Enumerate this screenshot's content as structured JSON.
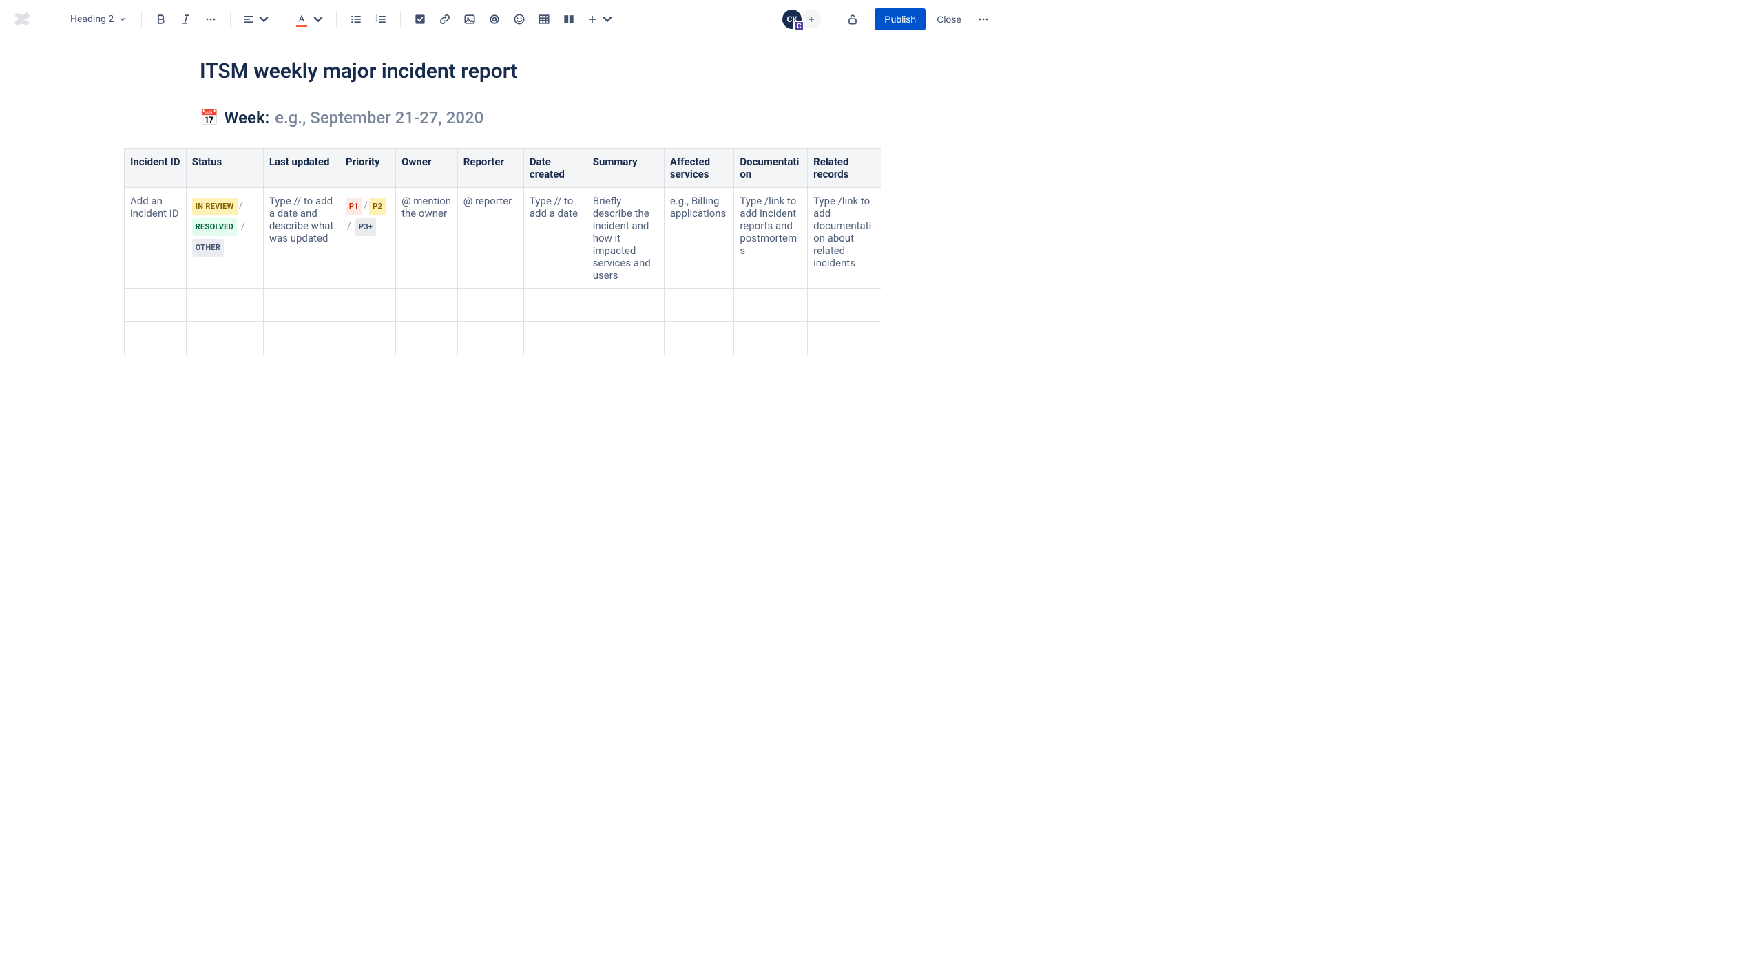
{
  "toolbar": {
    "style_dropdown": "Heading 2",
    "publish_label": "Publish",
    "close_label": "Close",
    "avatar_initials": "CK",
    "avatar_badge": "C"
  },
  "page": {
    "title": "ITSM weekly major incident report",
    "week_label": "Week:",
    "week_placeholder": "e.g., September 21-27, 2020"
  },
  "table": {
    "headers": [
      "Incident ID",
      "Status",
      "Last updated",
      "Priority",
      "Owner",
      "Reporter",
      "Date created",
      "Summary",
      "Affected services",
      "Documentation",
      "Related records"
    ],
    "col_widths": [
      "84px",
      "105px",
      "104px",
      "76px",
      "84px",
      "90px",
      "86px",
      "105px",
      "95px",
      "100px",
      "100px"
    ],
    "row": {
      "incident_id": "Add an incident ID",
      "status_lozenges": [
        "IN REVIEW",
        "RESOLVED",
        "OTHER"
      ],
      "last_updated": "Type // to add a date and describe what was updated",
      "priority_lozenges": [
        "P1",
        "P2",
        "P3+"
      ],
      "owner": "@ mention the owner",
      "reporter": "@ reporter",
      "date_created": "Type // to add a date",
      "summary": "Briefly describe the incident and how it impacted services and users",
      "affected": "e.g., Billing applications",
      "documentation": "Type /link to add incident reports and postmortems",
      "related": "Type /link to add documentation about related incidents"
    }
  }
}
